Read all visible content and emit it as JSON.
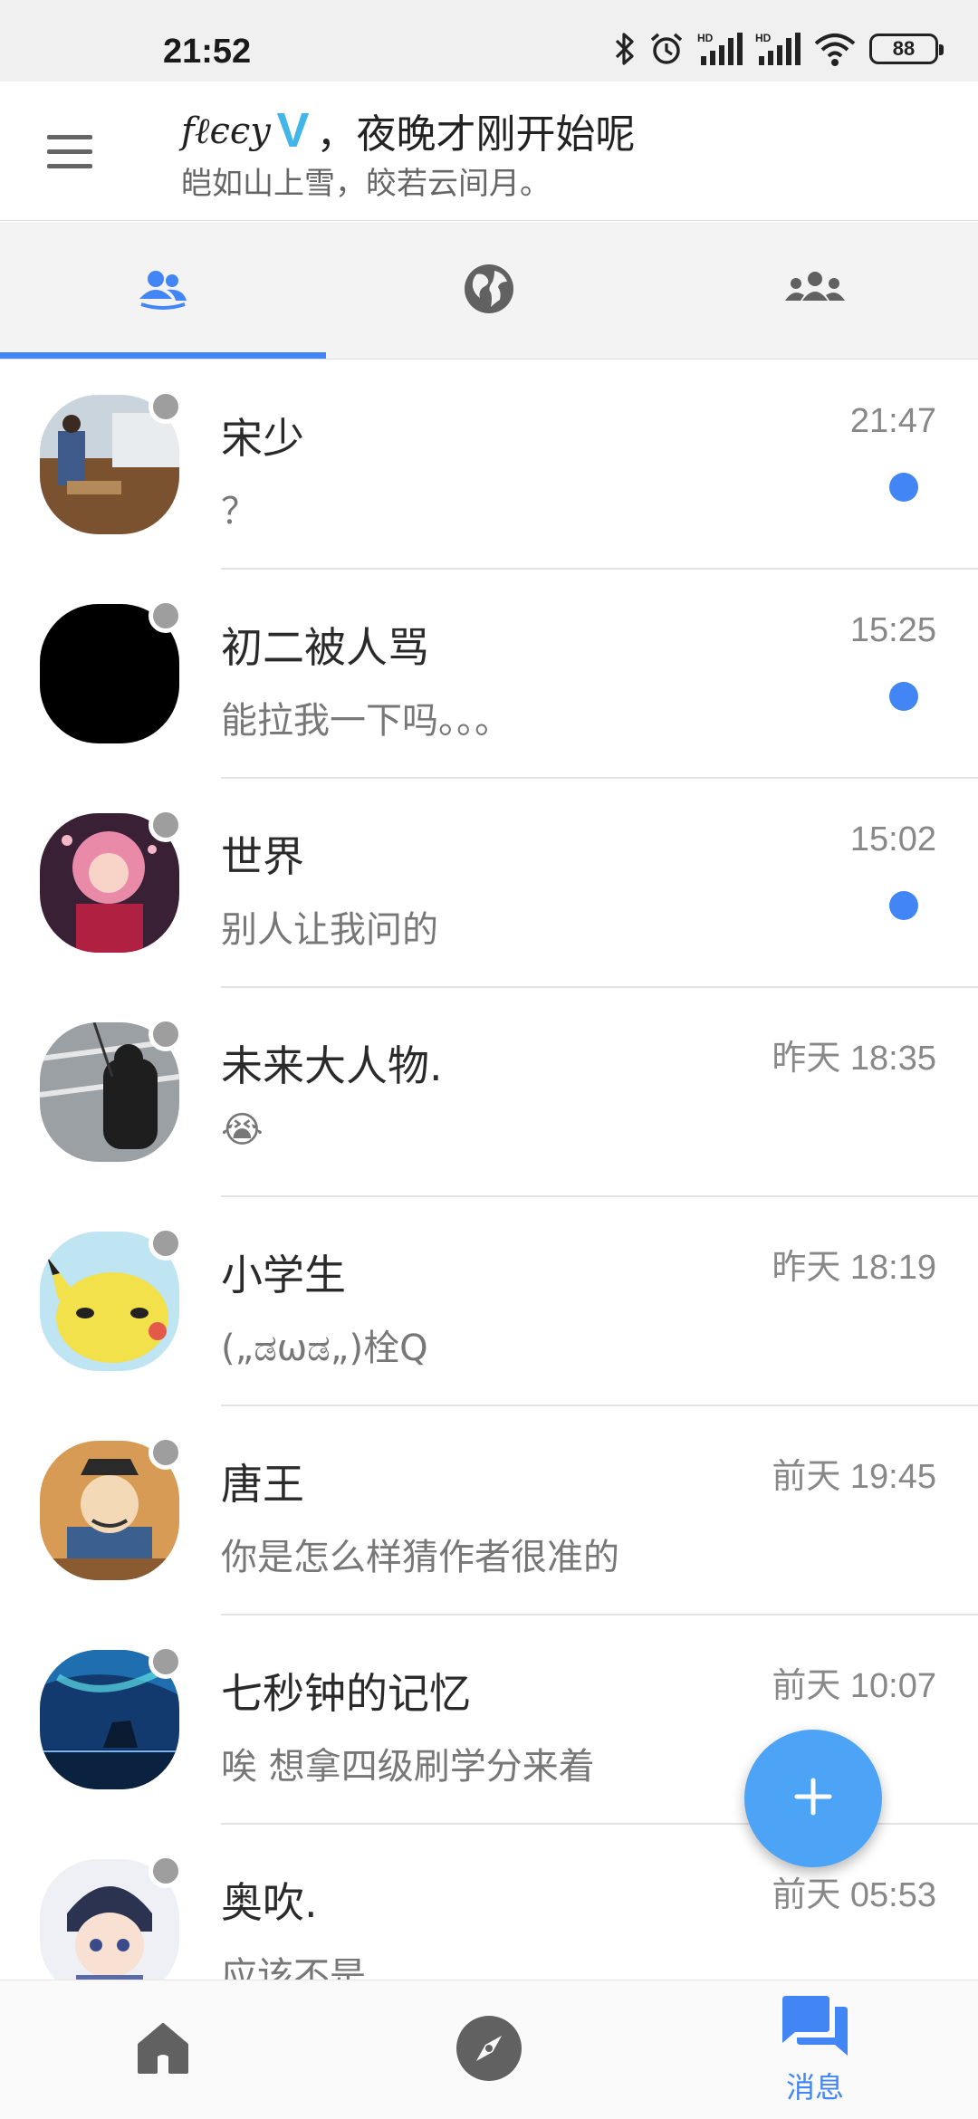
{
  "status_bar": {
    "time": "21:52",
    "battery": "88",
    "icons": [
      "bluetooth-icon",
      "alarm-icon",
      "signal-icon",
      "signal-icon",
      "wifi-icon",
      "battery-icon"
    ]
  },
  "header": {
    "menu_icon": "menu-icon",
    "name": "fℓєєу",
    "vip_badge": "V",
    "greeting": "，夜晚才刚开始呢",
    "subtitle": "皑如山上雪，皎若云间月。"
  },
  "tabs": [
    {
      "icon": "contacts-icon",
      "active": true
    },
    {
      "icon": "globe-icon",
      "active": false
    },
    {
      "icon": "groups-icon",
      "active": false
    }
  ],
  "chats": [
    {
      "name": "宋少",
      "message": "？",
      "time": "21:47",
      "unread": true
    },
    {
      "name": "初二被人骂",
      "message": "能拉我一下吗。。。",
      "time": "15:25",
      "unread": true
    },
    {
      "name": "世界",
      "message": "别人让我问的",
      "time": "15:02",
      "unread": true
    },
    {
      "name": "未来大人物.",
      "message": "😭",
      "time": "昨天 18:35",
      "unread": false
    },
    {
      "name": "小学生",
      "message": "(„ಡωಡ„)栓Q",
      "time": "昨天 18:19",
      "unread": false
    },
    {
      "name": "唐王",
      "message": "你是怎么样猜作者很准的",
      "time": "前天 19:45",
      "unread": false
    },
    {
      "name": "七秒钟的记忆",
      "message": "唉 想拿四级刷学分来着",
      "time": "前天 10:07",
      "unread": false
    },
    {
      "name": "奥吹.",
      "message": "应该不是",
      "time": "前天 05:53",
      "unread": false
    }
  ],
  "fab": {
    "icon": "plus-icon"
  },
  "bottom_nav": [
    {
      "icon": "home-icon",
      "label": "",
      "active": false
    },
    {
      "icon": "compass-icon",
      "label": "",
      "active": false
    },
    {
      "icon": "chat-icon",
      "label": "消息",
      "active": true
    }
  ],
  "colors": {
    "accent": "#4285f4",
    "vip": "#42b6e8",
    "presence": "#9e9e9e",
    "fab": "#4da3f5"
  }
}
